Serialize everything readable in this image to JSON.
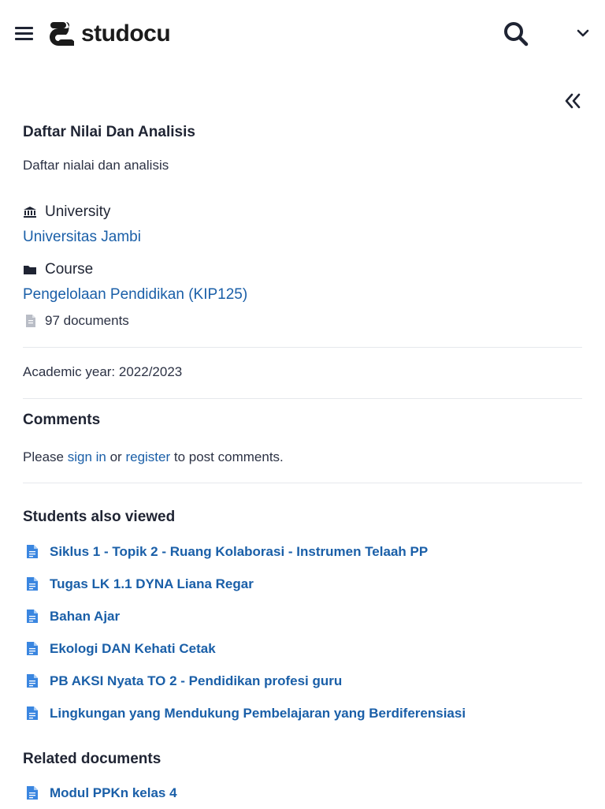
{
  "header": {
    "logo_text": "studocu",
    "menu_icon": "hamburger-icon",
    "search_icon": "search-icon",
    "dropdown_icon": "chevron-down-icon",
    "collapse_icon": "double-chevron-left-icon"
  },
  "document": {
    "title": "Daftar Nilai Dan Analisis",
    "description": "Daftar nialai dan analisis"
  },
  "meta": {
    "university_label": "University",
    "university_name": "Universitas Jambi",
    "course_label": "Course",
    "course_name": "Pengelolaan Pendidikan (KIP125)",
    "document_count": "97 documents",
    "academic_year": "Academic year: 2022/2023"
  },
  "comments": {
    "heading": "Comments",
    "prefix": "Please",
    "sign_in": "sign in",
    "middle": "or",
    "register": "register",
    "suffix": "to post comments."
  },
  "students_also_viewed": {
    "heading": "Students also viewed",
    "items": [
      "Siklus 1 - Topik 2 - Ruang Kolaborasi - Instrumen Telaah PP",
      "Tugas LK 1.1 DYNA Liana Regar",
      "Bahan Ajar",
      "Ekologi DAN Kehati Cetak",
      "PB AKSI Nyata TO 2 - Pendidikan profesi guru",
      "Lingkungan yang Mendukung Pembelajaran yang Berdiferensiasi"
    ]
  },
  "related_documents": {
    "heading": "Related documents",
    "items": [
      "Modul PPKn kelas 4"
    ]
  },
  "colors": {
    "link": "#1a5fa8",
    "text": "#1f2433",
    "divider": "#e6e8ec",
    "file_icon": "#3a86e0"
  }
}
